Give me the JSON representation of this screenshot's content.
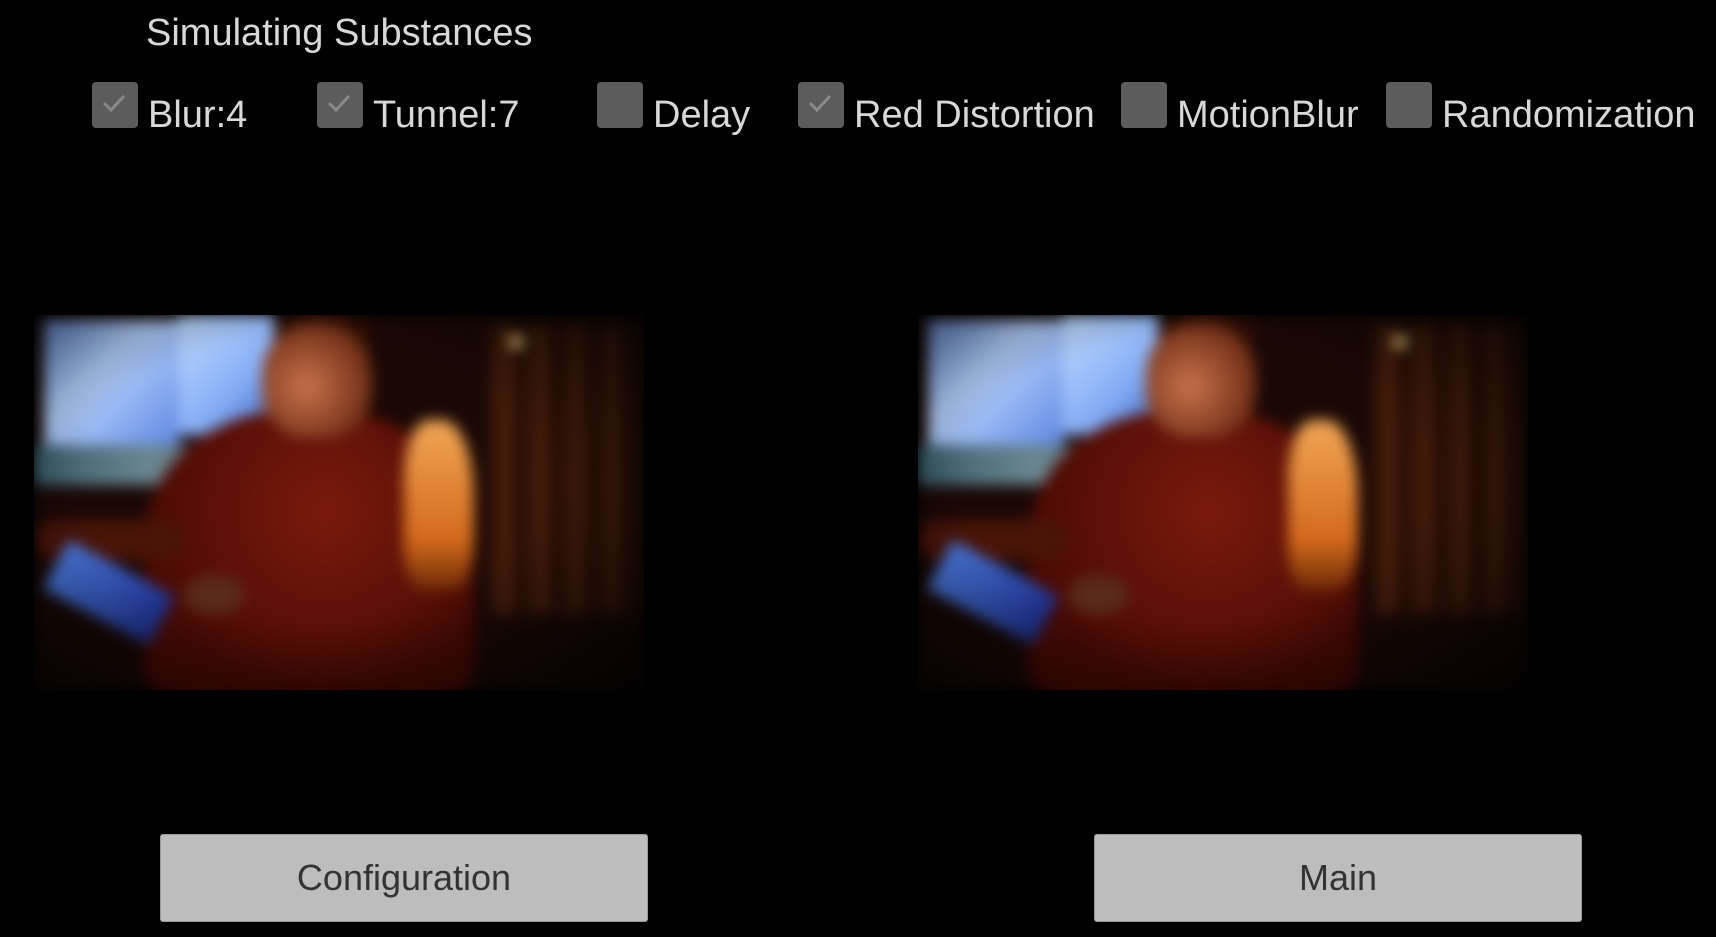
{
  "title": "Simulating Substances",
  "options": [
    {
      "label": "Blur:4",
      "checked": true
    },
    {
      "label": "Tunnel:7",
      "checked": true
    },
    {
      "label": "Delay",
      "checked": false
    },
    {
      "label": "Red Distortion",
      "checked": true
    },
    {
      "label": "MotionBlur",
      "checked": false
    },
    {
      "label": "Randomization",
      "checked": false
    }
  ],
  "buttons": {
    "configuration": "Configuration",
    "main": "Main"
  },
  "colors": {
    "background": "#000000",
    "checkbox": "#5c5c5c",
    "button": "#bdbdbd",
    "text": "#d8d8d8"
  }
}
